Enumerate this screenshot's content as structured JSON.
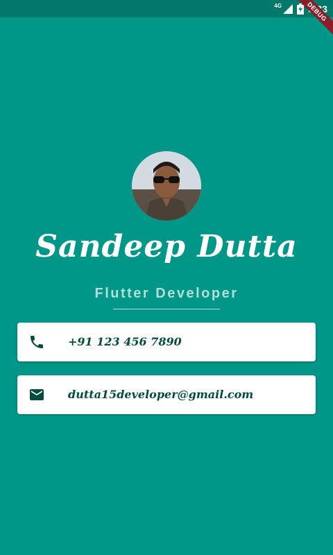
{
  "status_bar": {
    "network": "4G",
    "time": "6:33"
  },
  "debug_banner": {
    "label": "DEBUG"
  },
  "profile": {
    "name": "Sandeep Dutta",
    "title": "Flutter Developer"
  },
  "contact": {
    "phone": "+91 123 456 7890",
    "email": "dutta15developer@gmail.com"
  },
  "colors": {
    "background": "#009688",
    "status_bar": "#00796B",
    "accent_text": "#B2DFDB",
    "card_text": "#004D40",
    "icon": "#004D40"
  },
  "icons": {
    "phone": "phone-icon",
    "email": "email-icon"
  }
}
